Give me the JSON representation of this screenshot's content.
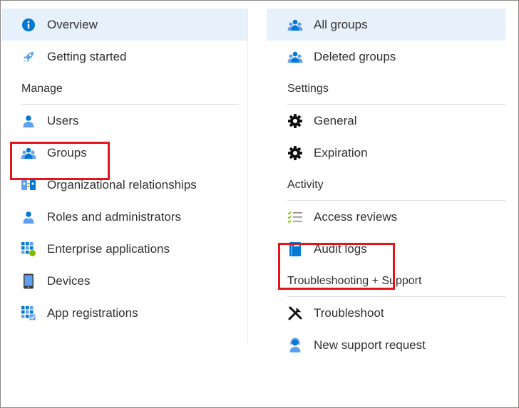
{
  "left_nav": {
    "items_top": [
      {
        "label": "Overview",
        "icon": "info-icon",
        "selected": true
      },
      {
        "label": "Getting started",
        "icon": "rocket-icon",
        "selected": false
      }
    ],
    "manage_header": "Manage",
    "manage_items": [
      {
        "label": "Users",
        "icon": "user-icon"
      },
      {
        "label": "Groups",
        "icon": "groups-icon"
      },
      {
        "label": "Organizational relationships",
        "icon": "org-relationships-icon"
      },
      {
        "label": "Roles and administrators",
        "icon": "roles-icon"
      },
      {
        "label": "Enterprise applications",
        "icon": "enterprise-apps-icon"
      },
      {
        "label": "Devices",
        "icon": "device-icon"
      },
      {
        "label": "App registrations",
        "icon": "app-registrations-icon"
      }
    ]
  },
  "right_nav": {
    "items_top": [
      {
        "label": "All groups",
        "icon": "groups-icon",
        "selected": true
      },
      {
        "label": "Deleted groups",
        "icon": "groups-icon",
        "selected": false
      }
    ],
    "settings_header": "Settings",
    "settings_items": [
      {
        "label": "General",
        "icon": "gear-icon"
      },
      {
        "label": "Expiration",
        "icon": "gear-icon"
      }
    ],
    "activity_header": "Activity",
    "activity_items": [
      {
        "label": "Access reviews",
        "icon": "checklist-icon"
      },
      {
        "label": "Audit logs",
        "icon": "book-icon"
      }
    ],
    "troubleshooting_header": "Troubleshooting + Support",
    "troubleshooting_items": [
      {
        "label": "Troubleshoot",
        "icon": "tools-icon"
      },
      {
        "label": "New support request",
        "icon": "support-person-icon"
      }
    ]
  },
  "colors": {
    "selected_bg": "#e7f1fb",
    "highlight_red": "#e3151b",
    "icon_blue": "#0078d4",
    "icon_light_blue": "#5ea0ef"
  }
}
